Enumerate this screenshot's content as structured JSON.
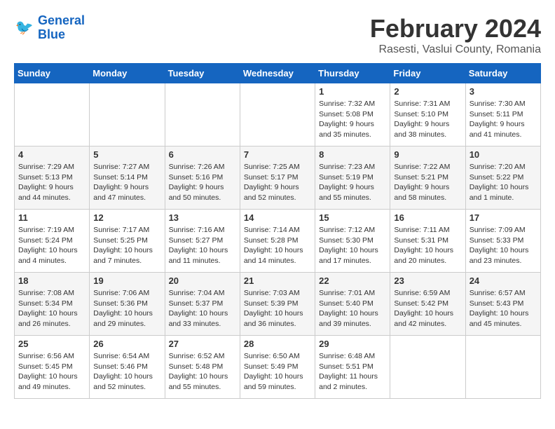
{
  "header": {
    "logo_line1": "General",
    "logo_line2": "Blue",
    "month": "February 2024",
    "location": "Rasesti, Vaslui County, Romania"
  },
  "days_of_week": [
    "Sunday",
    "Monday",
    "Tuesday",
    "Wednesday",
    "Thursday",
    "Friday",
    "Saturday"
  ],
  "weeks": [
    [
      {
        "day": "",
        "info": ""
      },
      {
        "day": "",
        "info": ""
      },
      {
        "day": "",
        "info": ""
      },
      {
        "day": "",
        "info": ""
      },
      {
        "day": "1",
        "info": "Sunrise: 7:32 AM\nSunset: 5:08 PM\nDaylight: 9 hours and 35 minutes."
      },
      {
        "day": "2",
        "info": "Sunrise: 7:31 AM\nSunset: 5:10 PM\nDaylight: 9 hours and 38 minutes."
      },
      {
        "day": "3",
        "info": "Sunrise: 7:30 AM\nSunset: 5:11 PM\nDaylight: 9 hours and 41 minutes."
      }
    ],
    [
      {
        "day": "4",
        "info": "Sunrise: 7:29 AM\nSunset: 5:13 PM\nDaylight: 9 hours and 44 minutes."
      },
      {
        "day": "5",
        "info": "Sunrise: 7:27 AM\nSunset: 5:14 PM\nDaylight: 9 hours and 47 minutes."
      },
      {
        "day": "6",
        "info": "Sunrise: 7:26 AM\nSunset: 5:16 PM\nDaylight: 9 hours and 50 minutes."
      },
      {
        "day": "7",
        "info": "Sunrise: 7:25 AM\nSunset: 5:17 PM\nDaylight: 9 hours and 52 minutes."
      },
      {
        "day": "8",
        "info": "Sunrise: 7:23 AM\nSunset: 5:19 PM\nDaylight: 9 hours and 55 minutes."
      },
      {
        "day": "9",
        "info": "Sunrise: 7:22 AM\nSunset: 5:21 PM\nDaylight: 9 hours and 58 minutes."
      },
      {
        "day": "10",
        "info": "Sunrise: 7:20 AM\nSunset: 5:22 PM\nDaylight: 10 hours and 1 minute."
      }
    ],
    [
      {
        "day": "11",
        "info": "Sunrise: 7:19 AM\nSunset: 5:24 PM\nDaylight: 10 hours and 4 minutes."
      },
      {
        "day": "12",
        "info": "Sunrise: 7:17 AM\nSunset: 5:25 PM\nDaylight: 10 hours and 7 minutes."
      },
      {
        "day": "13",
        "info": "Sunrise: 7:16 AM\nSunset: 5:27 PM\nDaylight: 10 hours and 11 minutes."
      },
      {
        "day": "14",
        "info": "Sunrise: 7:14 AM\nSunset: 5:28 PM\nDaylight: 10 hours and 14 minutes."
      },
      {
        "day": "15",
        "info": "Sunrise: 7:12 AM\nSunset: 5:30 PM\nDaylight: 10 hours and 17 minutes."
      },
      {
        "day": "16",
        "info": "Sunrise: 7:11 AM\nSunset: 5:31 PM\nDaylight: 10 hours and 20 minutes."
      },
      {
        "day": "17",
        "info": "Sunrise: 7:09 AM\nSunset: 5:33 PM\nDaylight: 10 hours and 23 minutes."
      }
    ],
    [
      {
        "day": "18",
        "info": "Sunrise: 7:08 AM\nSunset: 5:34 PM\nDaylight: 10 hours and 26 minutes."
      },
      {
        "day": "19",
        "info": "Sunrise: 7:06 AM\nSunset: 5:36 PM\nDaylight: 10 hours and 29 minutes."
      },
      {
        "day": "20",
        "info": "Sunrise: 7:04 AM\nSunset: 5:37 PM\nDaylight: 10 hours and 33 minutes."
      },
      {
        "day": "21",
        "info": "Sunrise: 7:03 AM\nSunset: 5:39 PM\nDaylight: 10 hours and 36 minutes."
      },
      {
        "day": "22",
        "info": "Sunrise: 7:01 AM\nSunset: 5:40 PM\nDaylight: 10 hours and 39 minutes."
      },
      {
        "day": "23",
        "info": "Sunrise: 6:59 AM\nSunset: 5:42 PM\nDaylight: 10 hours and 42 minutes."
      },
      {
        "day": "24",
        "info": "Sunrise: 6:57 AM\nSunset: 5:43 PM\nDaylight: 10 hours and 45 minutes."
      }
    ],
    [
      {
        "day": "25",
        "info": "Sunrise: 6:56 AM\nSunset: 5:45 PM\nDaylight: 10 hours and 49 minutes."
      },
      {
        "day": "26",
        "info": "Sunrise: 6:54 AM\nSunset: 5:46 PM\nDaylight: 10 hours and 52 minutes."
      },
      {
        "day": "27",
        "info": "Sunrise: 6:52 AM\nSunset: 5:48 PM\nDaylight: 10 hours and 55 minutes."
      },
      {
        "day": "28",
        "info": "Sunrise: 6:50 AM\nSunset: 5:49 PM\nDaylight: 10 hours and 59 minutes."
      },
      {
        "day": "29",
        "info": "Sunrise: 6:48 AM\nSunset: 5:51 PM\nDaylight: 11 hours and 2 minutes."
      },
      {
        "day": "",
        "info": ""
      },
      {
        "day": "",
        "info": ""
      }
    ]
  ]
}
